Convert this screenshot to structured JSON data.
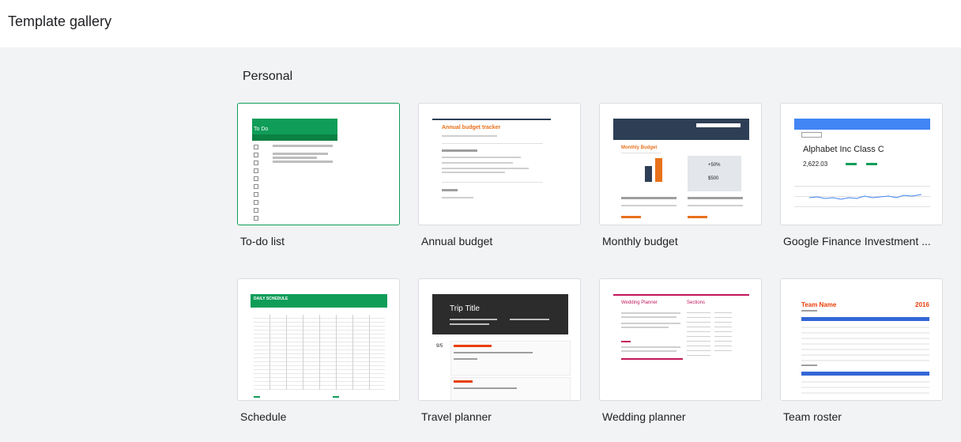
{
  "header": {
    "title": "Template gallery"
  },
  "section": {
    "title": "Personal"
  },
  "colors": {
    "green": "#0f9d58",
    "orange": "#e8711a",
    "navy": "#2e3e55",
    "blue": "#4285f4",
    "magenta": "#c2185b",
    "red": "#e8400c"
  },
  "templates": [
    {
      "label": "To-do list",
      "thumb": {
        "title": "To Do"
      }
    },
    {
      "label": "Annual budget",
      "thumb": {
        "title": "Annual budget tracker"
      }
    },
    {
      "label": "Monthly budget",
      "thumb": {
        "title": "Monthly Budget",
        "percent": "+50%",
        "amount": "$500"
      }
    },
    {
      "label": "Google Finance Investment ...",
      "thumb": {
        "title": "Alphabet Inc Class C",
        "price": "2,622.03"
      }
    },
    {
      "label": "Schedule",
      "thumb": {
        "title": "DAILY SCHEDULE"
      }
    },
    {
      "label": "Travel planner",
      "thumb": {
        "title": "Trip Title",
        "date": "9/5"
      }
    },
    {
      "label": "Wedding planner",
      "thumb": {
        "title": "Wedding Planner",
        "sections": "Sections"
      }
    },
    {
      "label": "Team roster",
      "thumb": {
        "title": "Team Name",
        "year": "2016"
      }
    }
  ]
}
